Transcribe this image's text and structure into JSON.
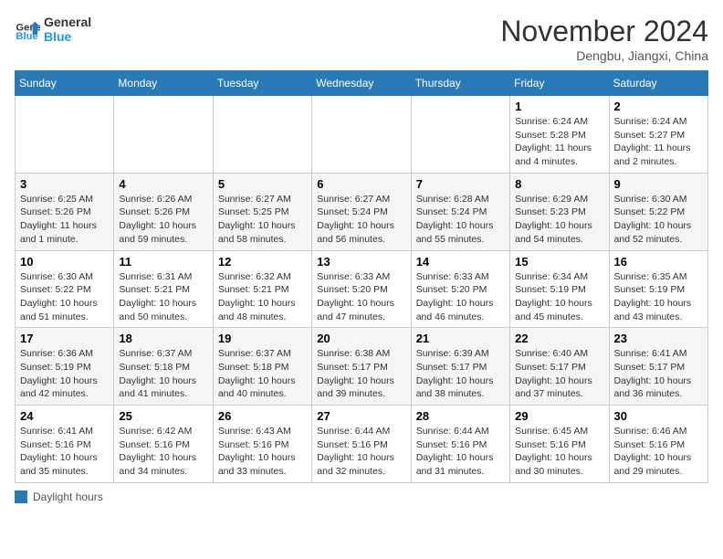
{
  "header": {
    "logo_general": "General",
    "logo_blue": "Blue",
    "month_title": "November 2024",
    "location": "Dengbu, Jiangxi, China"
  },
  "weekdays": [
    "Sunday",
    "Monday",
    "Tuesday",
    "Wednesday",
    "Thursday",
    "Friday",
    "Saturday"
  ],
  "weeks": [
    [
      {
        "day": "",
        "info": ""
      },
      {
        "day": "",
        "info": ""
      },
      {
        "day": "",
        "info": ""
      },
      {
        "day": "",
        "info": ""
      },
      {
        "day": "",
        "info": ""
      },
      {
        "day": "1",
        "info": "Sunrise: 6:24 AM\nSunset: 5:28 PM\nDaylight: 11 hours and 4 minutes."
      },
      {
        "day": "2",
        "info": "Sunrise: 6:24 AM\nSunset: 5:27 PM\nDaylight: 11 hours and 2 minutes."
      }
    ],
    [
      {
        "day": "3",
        "info": "Sunrise: 6:25 AM\nSunset: 5:26 PM\nDaylight: 11 hours and 1 minute."
      },
      {
        "day": "4",
        "info": "Sunrise: 6:26 AM\nSunset: 5:26 PM\nDaylight: 10 hours and 59 minutes."
      },
      {
        "day": "5",
        "info": "Sunrise: 6:27 AM\nSunset: 5:25 PM\nDaylight: 10 hours and 58 minutes."
      },
      {
        "day": "6",
        "info": "Sunrise: 6:27 AM\nSunset: 5:24 PM\nDaylight: 10 hours and 56 minutes."
      },
      {
        "day": "7",
        "info": "Sunrise: 6:28 AM\nSunset: 5:24 PM\nDaylight: 10 hours and 55 minutes."
      },
      {
        "day": "8",
        "info": "Sunrise: 6:29 AM\nSunset: 5:23 PM\nDaylight: 10 hours and 54 minutes."
      },
      {
        "day": "9",
        "info": "Sunrise: 6:30 AM\nSunset: 5:22 PM\nDaylight: 10 hours and 52 minutes."
      }
    ],
    [
      {
        "day": "10",
        "info": "Sunrise: 6:30 AM\nSunset: 5:22 PM\nDaylight: 10 hours and 51 minutes."
      },
      {
        "day": "11",
        "info": "Sunrise: 6:31 AM\nSunset: 5:21 PM\nDaylight: 10 hours and 50 minutes."
      },
      {
        "day": "12",
        "info": "Sunrise: 6:32 AM\nSunset: 5:21 PM\nDaylight: 10 hours and 48 minutes."
      },
      {
        "day": "13",
        "info": "Sunrise: 6:33 AM\nSunset: 5:20 PM\nDaylight: 10 hours and 47 minutes."
      },
      {
        "day": "14",
        "info": "Sunrise: 6:33 AM\nSunset: 5:20 PM\nDaylight: 10 hours and 46 minutes."
      },
      {
        "day": "15",
        "info": "Sunrise: 6:34 AM\nSunset: 5:19 PM\nDaylight: 10 hours and 45 minutes."
      },
      {
        "day": "16",
        "info": "Sunrise: 6:35 AM\nSunset: 5:19 PM\nDaylight: 10 hours and 43 minutes."
      }
    ],
    [
      {
        "day": "17",
        "info": "Sunrise: 6:36 AM\nSunset: 5:19 PM\nDaylight: 10 hours and 42 minutes."
      },
      {
        "day": "18",
        "info": "Sunrise: 6:37 AM\nSunset: 5:18 PM\nDaylight: 10 hours and 41 minutes."
      },
      {
        "day": "19",
        "info": "Sunrise: 6:37 AM\nSunset: 5:18 PM\nDaylight: 10 hours and 40 minutes."
      },
      {
        "day": "20",
        "info": "Sunrise: 6:38 AM\nSunset: 5:17 PM\nDaylight: 10 hours and 39 minutes."
      },
      {
        "day": "21",
        "info": "Sunrise: 6:39 AM\nSunset: 5:17 PM\nDaylight: 10 hours and 38 minutes."
      },
      {
        "day": "22",
        "info": "Sunrise: 6:40 AM\nSunset: 5:17 PM\nDaylight: 10 hours and 37 minutes."
      },
      {
        "day": "23",
        "info": "Sunrise: 6:41 AM\nSunset: 5:17 PM\nDaylight: 10 hours and 36 minutes."
      }
    ],
    [
      {
        "day": "24",
        "info": "Sunrise: 6:41 AM\nSunset: 5:16 PM\nDaylight: 10 hours and 35 minutes."
      },
      {
        "day": "25",
        "info": "Sunrise: 6:42 AM\nSunset: 5:16 PM\nDaylight: 10 hours and 34 minutes."
      },
      {
        "day": "26",
        "info": "Sunrise: 6:43 AM\nSunset: 5:16 PM\nDaylight: 10 hours and 33 minutes."
      },
      {
        "day": "27",
        "info": "Sunrise: 6:44 AM\nSunset: 5:16 PM\nDaylight: 10 hours and 32 minutes."
      },
      {
        "day": "28",
        "info": "Sunrise: 6:44 AM\nSunset: 5:16 PM\nDaylight: 10 hours and 31 minutes."
      },
      {
        "day": "29",
        "info": "Sunrise: 6:45 AM\nSunset: 5:16 PM\nDaylight: 10 hours and 30 minutes."
      },
      {
        "day": "30",
        "info": "Sunrise: 6:46 AM\nSunset: 5:16 PM\nDaylight: 10 hours and 29 minutes."
      }
    ]
  ],
  "legend": {
    "label": "Daylight hours"
  }
}
